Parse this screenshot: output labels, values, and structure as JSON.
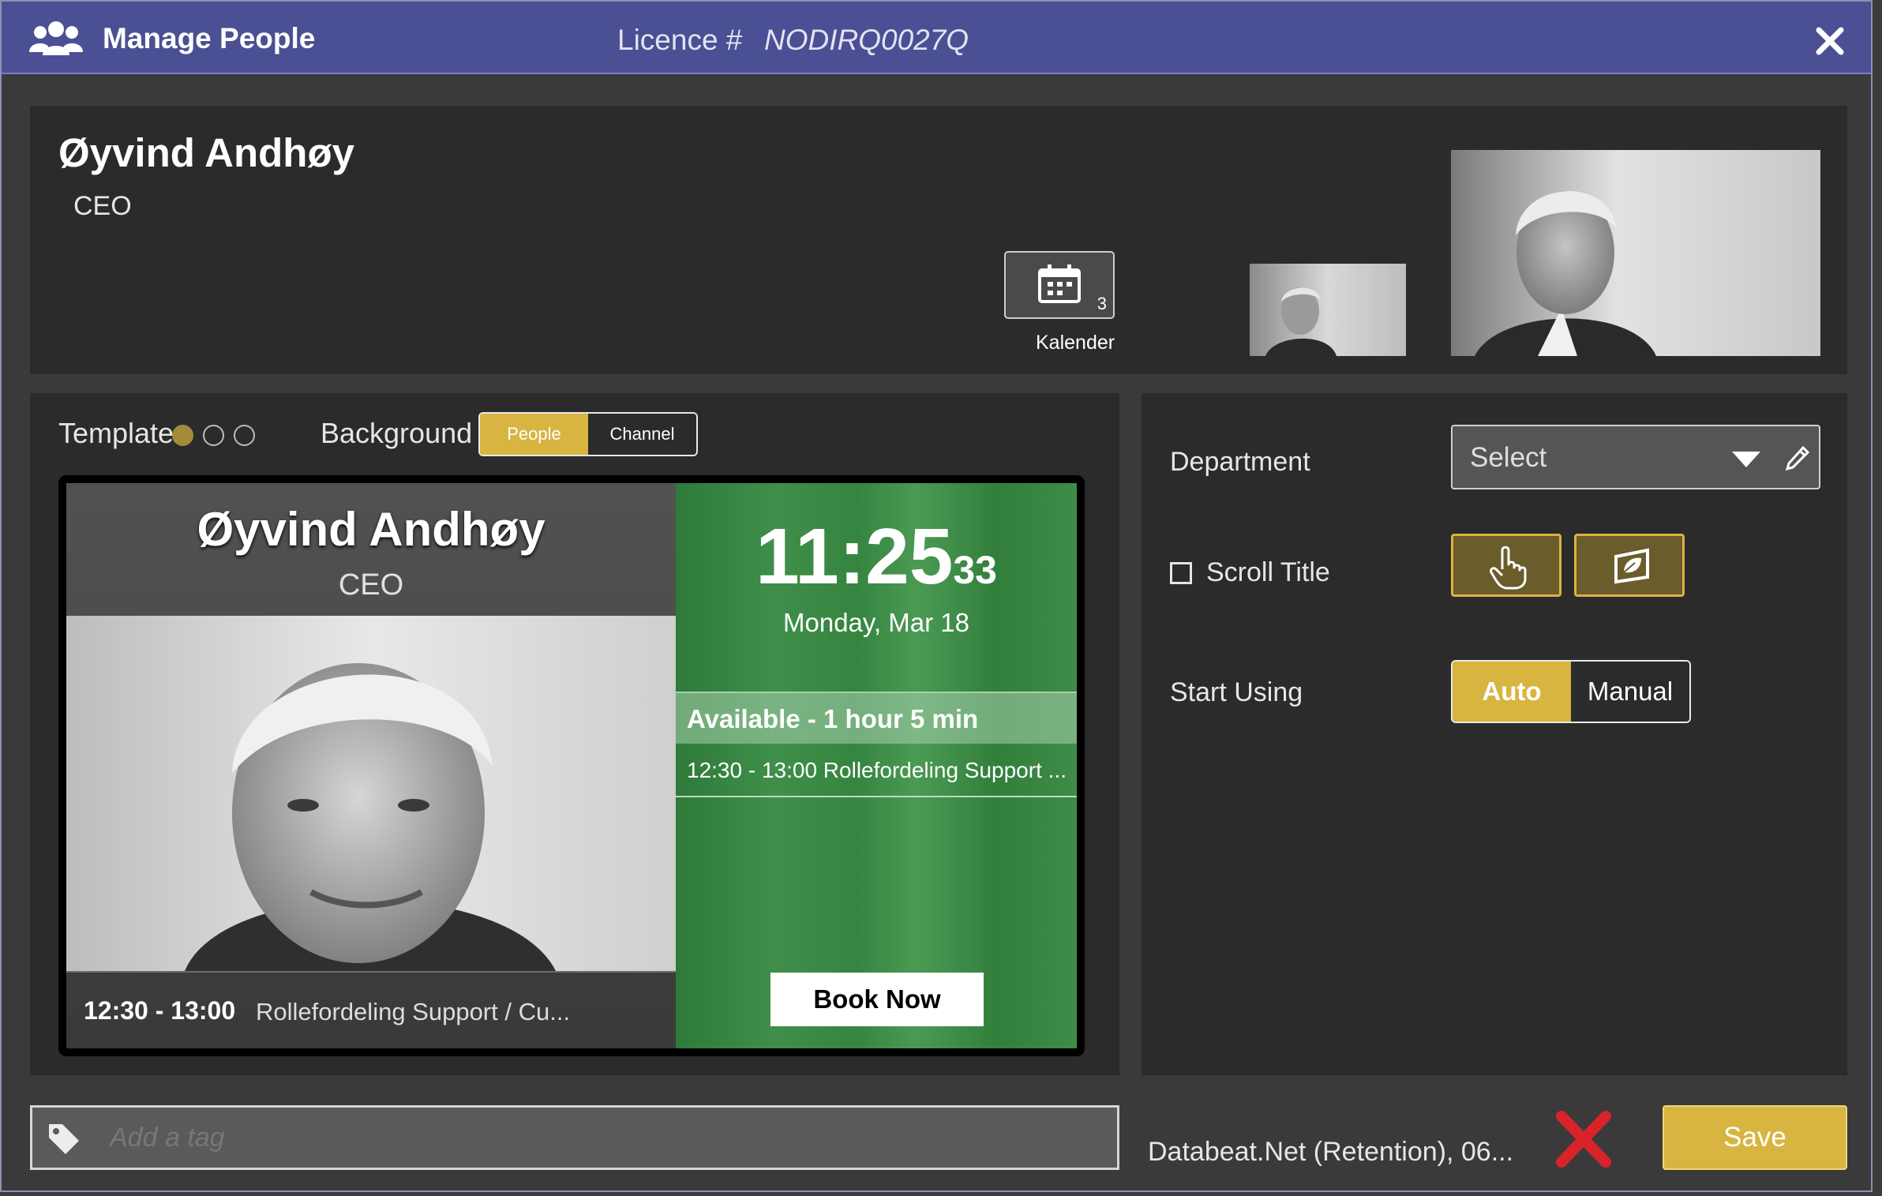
{
  "titlebar": {
    "title": "Manage People",
    "licence_label": "Licence #",
    "licence_value": "NODIRQ0027Q",
    "icon": "people-group-icon",
    "close_icon": "close-icon"
  },
  "person": {
    "name": "Øyvind Andhøy",
    "title": "CEO"
  },
  "calendar_button": {
    "count": "3",
    "label": "Kalender",
    "icon": "calendar-icon"
  },
  "template": {
    "label": "Template",
    "options_count": 3,
    "selected_index": 0
  },
  "background": {
    "label": "Background",
    "options": [
      "People",
      "Channel"
    ],
    "selected": "People"
  },
  "preview": {
    "name": "Øyvind Andhøy",
    "title": "CEO",
    "time_main": "11:25",
    "time_seconds": "33",
    "date": "Monday, Mar 18",
    "availability": "Available - 1 hour 5 min",
    "schedule": "12:30 - 13:00  Rollefordeling Support ...",
    "footer_time": "12:30 - 13:00",
    "footer_text": "Rollefordeling Support / Cu...",
    "book_label": "Book Now"
  },
  "settings": {
    "department_label": "Department",
    "department_value": "Select",
    "scroll_title_label": "Scroll Title",
    "scroll_title_checked": false,
    "start_using_label": "Start Using",
    "start_using_options": [
      "Auto",
      "Manual"
    ],
    "start_using_selected": "Auto"
  },
  "footer": {
    "tag_placeholder": "Add a tag",
    "status_text": "Databeat.Net (Retention), 06...",
    "save_label": "Save"
  },
  "colors": {
    "titlebar": "#4b4f93",
    "accent": "#d8b441",
    "panel": "#2b2b2b",
    "preview_green": "#3f8f4a",
    "delete_red": "#d9232a"
  }
}
